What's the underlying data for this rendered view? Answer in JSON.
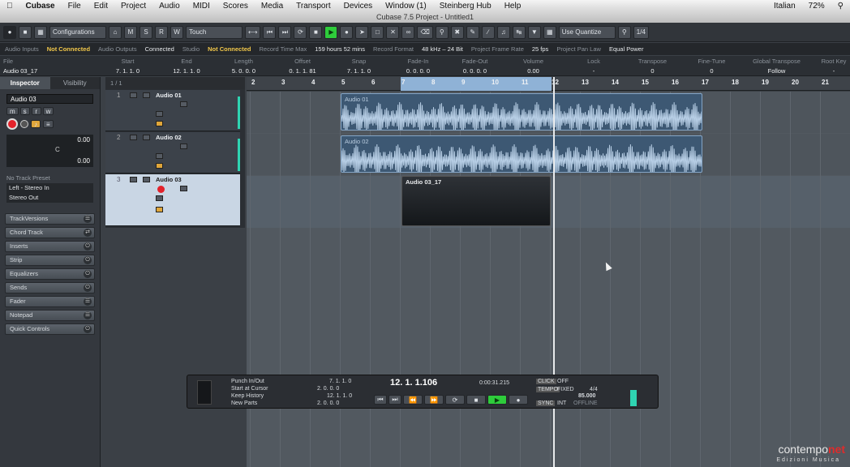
{
  "menubar": {
    "app": "Cubase",
    "items": [
      "File",
      "Edit",
      "Project",
      "Audio",
      "MIDI",
      "Scores",
      "Media",
      "Transport",
      "Devices",
      "Window (1)",
      "Steinberg Hub",
      "Help"
    ],
    "right_lang": "Italian",
    "right_battery": "72%"
  },
  "window": {
    "title": "Cubase 7.5 Project - Untitled1"
  },
  "toolbar": {
    "configurations": "Configurations",
    "touch": "Touch",
    "use_quantize": "Use Quantize",
    "quantize_value": "1/4",
    "mode_buttons": [
      "M",
      "S",
      "R",
      "W"
    ]
  },
  "status": {
    "audio_inputs_label": "Audio Inputs",
    "audio_inputs_value": "Not Connected",
    "audio_outputs_label": "Audio Outputs",
    "audio_outputs_value": "Connected",
    "studio_label": "Studio",
    "studio_value": "Not Connected",
    "record_time_label": "Record Time Max",
    "record_time_value": "159 hours 52 mins",
    "record_format_label": "Record Format",
    "record_format_value": "48 kHz – 24 Bit",
    "frame_rate_label": "Project Frame Rate",
    "frame_rate_value": "25 fps",
    "pan_law_label": "Project Pan Law",
    "pan_law_value": "Equal Power"
  },
  "infoline": {
    "columns": [
      {
        "label": "File",
        "value": "Audio 03_17"
      },
      {
        "label": "Start",
        "value": "7. 1. 1. 0"
      },
      {
        "label": "End",
        "value": "12. 1. 1. 0"
      },
      {
        "label": "Length",
        "value": "5. 0. 0. 0"
      },
      {
        "label": "Offset",
        "value": "0. 1. 1. 81"
      },
      {
        "label": "Snap",
        "value": "7. 1. 1. 0"
      },
      {
        "label": "Fade-In",
        "value": "0. 0. 0. 0"
      },
      {
        "label": "Fade-Out",
        "value": "0. 0. 0. 0"
      },
      {
        "label": "Volume",
        "value": "0.00"
      },
      {
        "label": "Lock",
        "value": "-"
      },
      {
        "label": "Transpose",
        "value": "0"
      },
      {
        "label": "Fine-Tune",
        "value": "0"
      },
      {
        "label": "Global Transpose",
        "value": "Follow"
      },
      {
        "label": "Root Key",
        "value": "-"
      }
    ]
  },
  "inspector": {
    "tab_inspector": "Inspector",
    "tab_visibility": "Visibility",
    "track_name": "Audio 03",
    "fader_value_1": "0.00",
    "pan_value": "C",
    "fader_value_2": "0.00",
    "track_preset": "No Track Preset",
    "input_routing": "Left - Stereo In",
    "output_routing": "Stereo Out",
    "sections": [
      "TrackVersions",
      "Chord Track",
      "Inserts",
      "Strip",
      "Equalizers",
      "Sends",
      "Fader",
      "Notepad",
      "Quick Controls"
    ]
  },
  "tracklist": {
    "header": "1 / 1",
    "tracks": [
      {
        "number": "1",
        "name": "Audio 01"
      },
      {
        "number": "2",
        "name": "Audio 02"
      },
      {
        "number": "3",
        "name": "Audio 03"
      }
    ]
  },
  "ruler": {
    "bars": [
      "2",
      "3",
      "4",
      "5",
      "6",
      "7",
      "8",
      "9",
      "10",
      "11",
      "12",
      "13",
      "14",
      "15",
      "16",
      "17",
      "18",
      "19",
      "20",
      "21"
    ]
  },
  "events": [
    {
      "name": "Audio 01"
    },
    {
      "name": "Audio 02"
    },
    {
      "name": "Audio 03_17"
    }
  ],
  "transport": {
    "punch_in_out": "Punch In/Out",
    "start_at_cursor": "Start at Cursor",
    "keep_history": "Keep History",
    "new_parts": "New Parts",
    "left_locator": "7. 1. 1. 0",
    "right_locator_top": "2. 0. 0. 0",
    "left_locator_bottom": "12. 1. 1. 0",
    "right_locator_bottom": "2. 0. 0. 0",
    "position": "12. 1. 1.106",
    "time": "0:00:31.215",
    "click": "CLICK",
    "click_state": "OFF",
    "tempo": "TEMPO",
    "tempo_state": "FIXED",
    "signature": "4/4",
    "tempo_value": "85.000",
    "sync": "SYNC",
    "sync_int": "INT",
    "sync_state": "OFFLINE"
  },
  "logo": {
    "brand_main": "contempo",
    "brand_net": "net",
    "brand_sub": "Edizioni Musica"
  }
}
